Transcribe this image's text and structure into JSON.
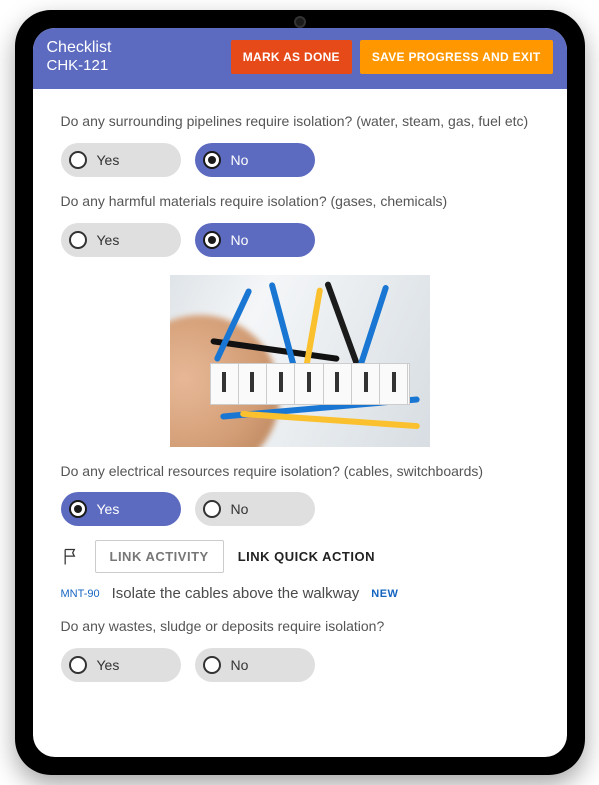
{
  "header": {
    "title": "Checklist",
    "subtitle": "CHK-121",
    "mark_done_label": "MARK AS DONE",
    "save_exit_label": "SAVE PROGRESS AND EXIT"
  },
  "options": {
    "yes": "Yes",
    "no": "No"
  },
  "questions": {
    "q1": {
      "text": "Do any surrounding pipelines require isolation? (water, steam, gas, fuel etc)",
      "selected": "no"
    },
    "q2": {
      "text": "Do any harmful materials require isolation? (gases, chemicals)",
      "selected": "no"
    },
    "q3": {
      "text": "Do any electrical resources require isolation? (cables, switchboards)",
      "selected": "yes"
    },
    "q4": {
      "text": "Do any wastes, sludge or deposits require isolation?",
      "selected": ""
    }
  },
  "link": {
    "button_label": "LINK ACTIVITY",
    "quick_label": "LINK QUICK ACTION",
    "ref": "MNT-90",
    "desc": "Isolate the cables above the walkway",
    "badge": "NEW"
  },
  "image": {
    "alt": "Electrical switchboard with multicoloured wiring and a hand using a screwdriver"
  }
}
